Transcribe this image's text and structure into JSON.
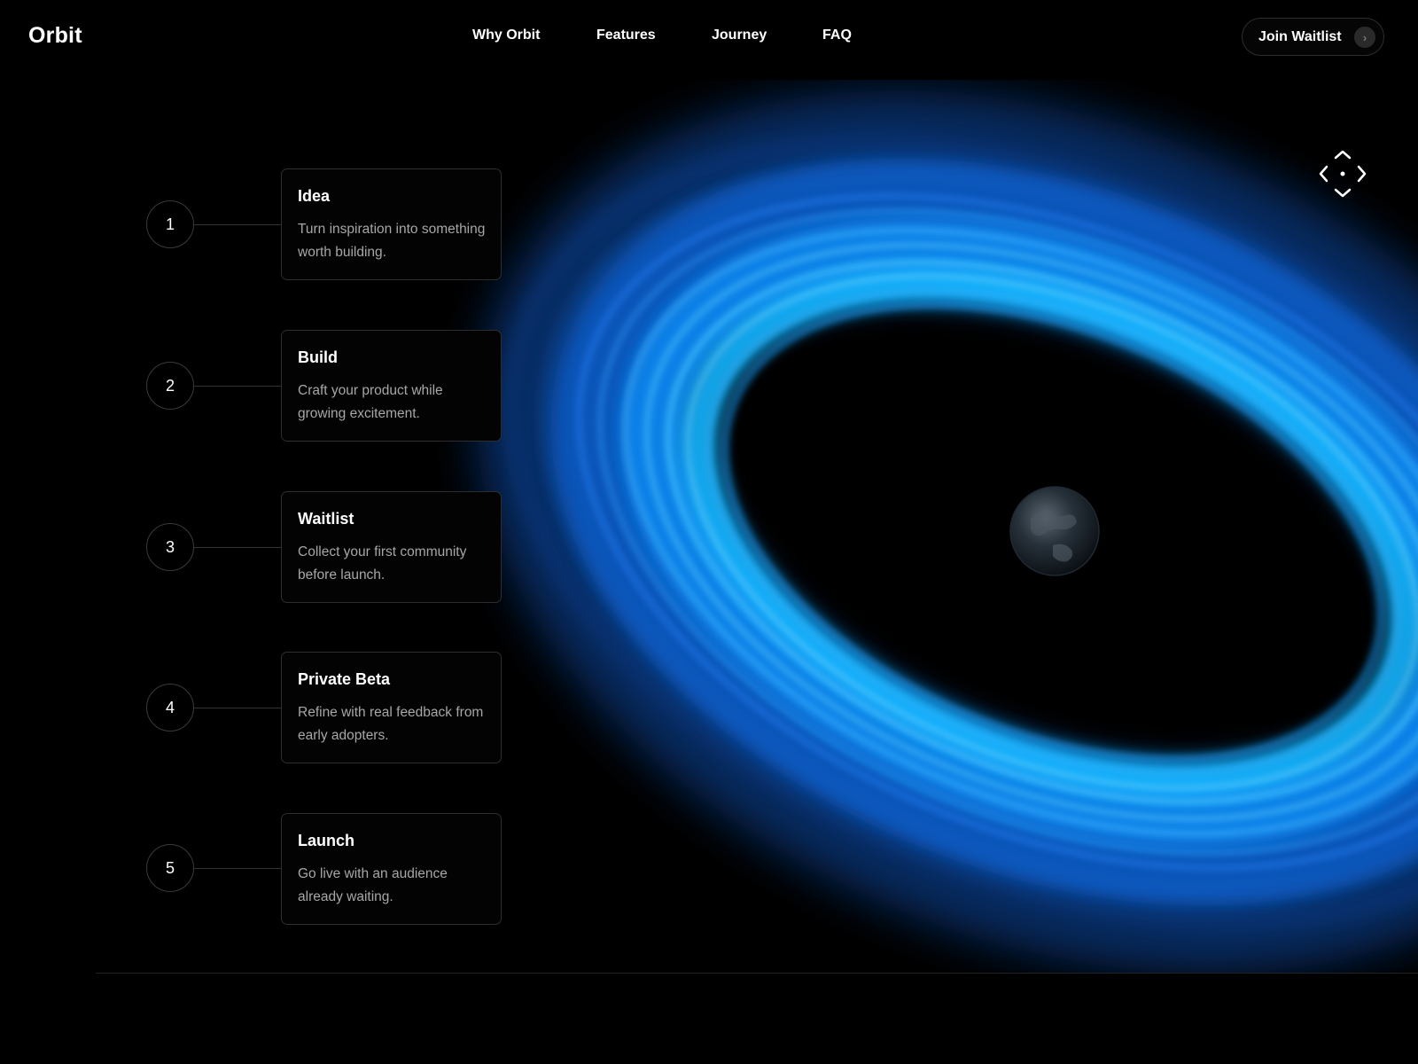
{
  "header": {
    "brand": "Orbit",
    "nav": [
      "Why Orbit",
      "Features",
      "Journey",
      "FAQ"
    ],
    "cta_label": "Join Waitlist",
    "cta_icon": "chevron-right-icon"
  },
  "controls": {
    "direction_icon": "move-arrows-icon"
  },
  "steps": [
    {
      "number": "1",
      "title": "Idea",
      "description": "Turn inspiration into something worth building."
    },
    {
      "number": "2",
      "title": "Build",
      "description": "Craft your product while growing excitement."
    },
    {
      "number": "3",
      "title": "Waitlist",
      "description": "Collect your first community before launch."
    },
    {
      "number": "4",
      "title": "Private Beta",
      "description": "Refine with real feedback from early adopters."
    },
    {
      "number": "5",
      "title": "Launch",
      "description": "Go live with an audience already waiting."
    }
  ],
  "colors": {
    "background": "#000000",
    "accent_blue": "#14a8ff",
    "text_muted": "#a7a7a7"
  }
}
